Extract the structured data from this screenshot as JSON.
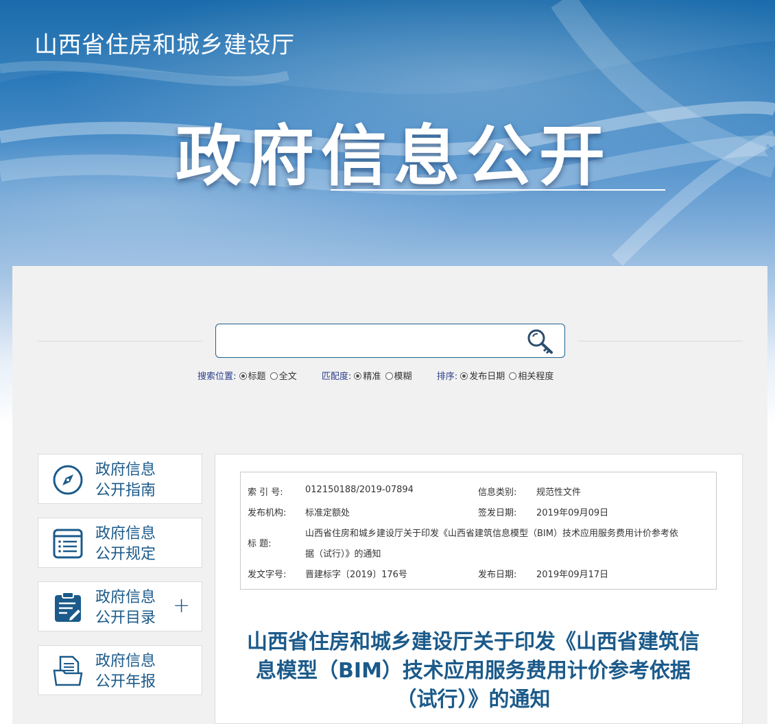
{
  "header": {
    "site_title": "山西省住房和城乡建设厅",
    "hero_title": "政府信息公开"
  },
  "search": {
    "placeholder": "",
    "position_label": "搜索位置:",
    "position_options": [
      "标题",
      "全文"
    ],
    "position_selected": "标题",
    "match_label": "匹配度:",
    "match_options": [
      "精准",
      "模糊"
    ],
    "match_selected": "精准",
    "sort_label": "排序:",
    "sort_options": [
      "发布日期",
      "相关程度"
    ],
    "sort_selected": "发布日期"
  },
  "sidebar": {
    "items": [
      {
        "line1": "政府信息",
        "line2": "公开指南",
        "icon": "compass-icon"
      },
      {
        "line1": "政府信息",
        "line2": "公开规定",
        "icon": "list-document-icon"
      },
      {
        "line1": "政府信息",
        "line2": "公开目录",
        "icon": "clipboard-edit-icon",
        "expand": "+"
      },
      {
        "line1": "政府信息",
        "line2": "公开年报",
        "icon": "folder-document-icon"
      }
    ]
  },
  "meta": {
    "index_label": "索  引  号:",
    "index_value": "012150188/2019-07894",
    "category_label": "信息类别:",
    "category_value": "规范性文件",
    "publisher_label": "发布机构:",
    "publisher_value": "标准定额处",
    "sign_date_label": "签发日期:",
    "sign_date_value": "2019年09月09日",
    "title_label": "标      题:",
    "title_line1": "山西省住房和城乡建设厅关于印发《山西省建筑信息模型（BIM）技术应用服务费用计价参考依",
    "title_line2": "据（试行）》的通知",
    "doc_no_label": "发文字号:",
    "doc_no_value": "晋建标字〔2019〕176号",
    "pub_date_label": "发布日期:",
    "pub_date_value": "2019年09月17日"
  },
  "document": {
    "title_line1": "山西省住房和城乡建设厅关于印发《山西省建筑信",
    "title_line2": "息模型（BIM）技术应用服务费用计价参考依据",
    "title_line3": "（试行）》的通知"
  },
  "colors": {
    "accent": "#1b5a8a",
    "banner_top": "#0c62a6",
    "panel_bg": "#f1f1f1"
  }
}
